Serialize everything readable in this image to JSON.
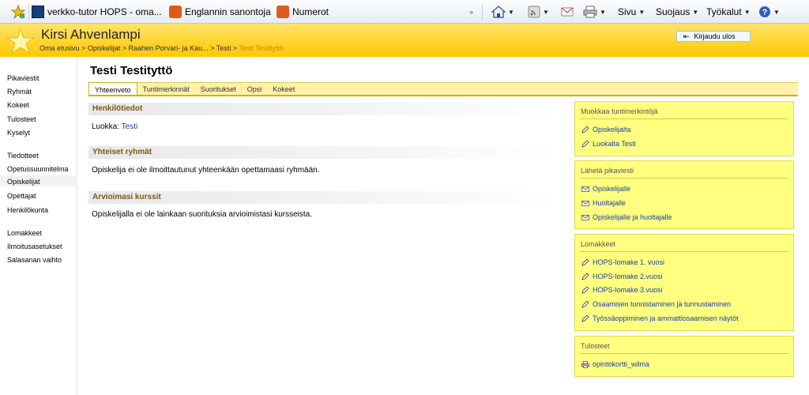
{
  "browser": {
    "favorites": [
      {
        "label": "verkko-tutor HOPS - oma...",
        "icon": "page-icon"
      },
      {
        "label": "Englannin sanontoja",
        "icon": "site-icon"
      },
      {
        "label": "Numerot",
        "icon": "site-icon"
      }
    ],
    "menus": {
      "sivu": "Sivu",
      "suojaus": "Suojaus",
      "tyokalut": "Työkalut"
    }
  },
  "header": {
    "user_name": "Kirsi Ahvenlampi",
    "breadcrumbs": [
      "Oma etusivu",
      "Opiskelijat",
      "Raahen Porvari- ja Kau...",
      "Testi"
    ],
    "breadcrumb_current": "Testi Testityttö",
    "separator": ">",
    "logout_label": "Kirjaudu ulos"
  },
  "nav": {
    "group1": [
      "Pikaviestit",
      "Ryhmät",
      "Kokeet",
      "Tulosteet",
      "Kyselyt"
    ],
    "group2": [
      "Tiedotteet",
      "Opetussuunnitelma",
      "Opiskelijat",
      "Opettajat",
      "Henkilökunta"
    ],
    "group3": [
      "Lomakkeet",
      "Ilmoitusasetukset",
      "Salasanan vaihto"
    ]
  },
  "main": {
    "title": "Testi Testityttö",
    "tabs": [
      "Yhteenveto",
      "Tuntimerkinnät",
      "Suoritukset",
      "Opsi",
      "Kokeet"
    ],
    "sections": [
      {
        "heading": "Henkilötiedot",
        "label": "Luokka:",
        "link": "Testi"
      },
      {
        "heading": "Yhteiset ryhmät",
        "text": "Opiskelija ei ole ilmoittautunut yhteenkään opettamaasi ryhmään."
      },
      {
        "heading": "Arvioimasi kurssit",
        "text": "Opiskelijalla ei ole lainkaan suorituksia arvioimistasi kursseista."
      }
    ]
  },
  "sidebar": {
    "boxes": [
      {
        "title": "Muokkaa tuntimerkintöjä",
        "links": [
          "Opiskelijalta",
          "Luokalta Testi"
        ]
      },
      {
        "title": "Lähetä pikaviesti",
        "links": [
          "Opiskelijalle",
          "Huoltajalle",
          "Opiskelijalle ja huoltajalle"
        ]
      },
      {
        "title": "Lomakkeet",
        "links": [
          "HOPS-lomake 1. vuosi",
          "HOPS-lomake 2.vuosi",
          "HOPS-lomake 3.vuosi",
          "Osaamisen tunnistaminen ja tunnustaminen",
          "Työssäoppiminen ja ammattiosaamisen näytöt"
        ]
      },
      {
        "title": "Tulosteet",
        "links": [
          "opintokortti_wilma"
        ]
      }
    ]
  },
  "colors": {
    "header": "#ffc800",
    "accent": "#1a3ea8",
    "panel": "#ffff80"
  }
}
